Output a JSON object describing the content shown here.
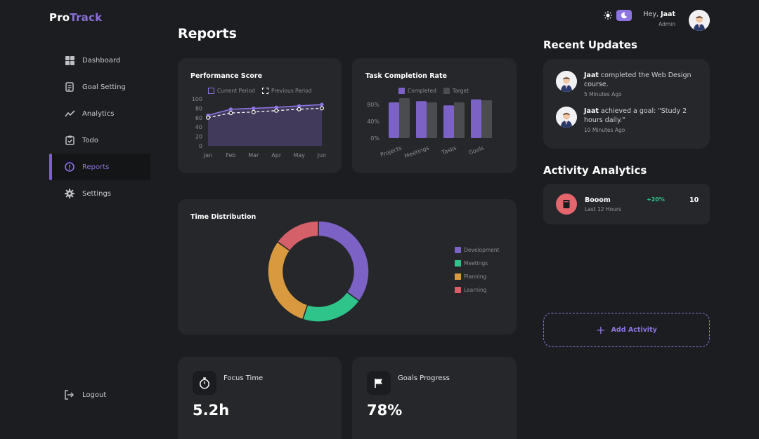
{
  "app": {
    "logo_pro": "Pro",
    "logo_track": "Track"
  },
  "sidebar": {
    "items": [
      {
        "label": "Dashboard",
        "icon": "grid-icon"
      },
      {
        "label": "Goal Setting",
        "icon": "clipboard-icon"
      },
      {
        "label": "Analytics",
        "icon": "trend-line-icon"
      },
      {
        "label": "Todo",
        "icon": "checklist-icon"
      },
      {
        "label": "Reports",
        "icon": "info-circle-icon",
        "active": true
      },
      {
        "label": "Settings",
        "icon": "gear-icon"
      }
    ],
    "logout": "Logout"
  },
  "header": {
    "page_title": "Reports",
    "greeting_prefix": "Hey,",
    "user_name": "Jaat",
    "user_role": "Admin"
  },
  "colors": {
    "accent": "#8d74e0",
    "background": "#1c1d20",
    "card": "#25272a",
    "development": "#7b62c4",
    "meetings": "#2fc48a",
    "planning": "#d99a3f",
    "learning": "#d4606a",
    "positive": "#2fc48a"
  },
  "performance": {
    "title": "Performance Score",
    "legend_current": "Current Period",
    "legend_previous": "Previous Period"
  },
  "completion": {
    "title": "Task Completion Rate",
    "legend_completed": "Completed",
    "legend_target": "Target"
  },
  "distribution": {
    "title": "Time Distribution"
  },
  "chart_data": [
    {
      "type": "line",
      "title": "Performance Score",
      "x": [
        "Jan",
        "Feb",
        "Mar",
        "Apr",
        "May",
        "Jun"
      ],
      "ylim": [
        0,
        100
      ],
      "yticks": [
        0,
        20,
        40,
        60,
        80,
        100
      ],
      "legend": "top",
      "series": [
        {
          "name": "Current Period",
          "values": [
            65,
            78,
            80,
            82,
            85,
            88
          ],
          "color": "#8d74e0",
          "fill": true
        },
        {
          "name": "Previous Period",
          "values": [
            60,
            70,
            72,
            75,
            78,
            80
          ],
          "color": "#ffffff",
          "dashed": true
        }
      ]
    },
    {
      "type": "bar",
      "title": "Task Completion Rate",
      "categories": [
        "Projects",
        "Meetings",
        "Tasks",
        "Goals"
      ],
      "ylim": [
        0,
        100
      ],
      "yticks": [
        "0%",
        "40%",
        "80%"
      ],
      "yticks_values": [
        0,
        40,
        80
      ],
      "legend": "top",
      "series": [
        {
          "name": "Completed",
          "values": [
            85,
            88,
            78,
            92
          ],
          "color": "#7b62c4"
        },
        {
          "name": "Target",
          "values": [
            95,
            85,
            85,
            90
          ],
          "color": "#4a4c50"
        }
      ]
    },
    {
      "type": "pie",
      "title": "Time Distribution",
      "donut": true,
      "labels": [
        "Development",
        "Meetings",
        "Planning",
        "Learning"
      ],
      "values": [
        35,
        20,
        30,
        15
      ],
      "colors": [
        "#7b62c4",
        "#2fc48a",
        "#d99a3f",
        "#d4606a"
      ],
      "legend": "right"
    }
  ],
  "stats": {
    "focus_title": "Focus Time",
    "focus_value": "5.2h",
    "goals_title": "Goals Progress",
    "goals_value": "78%"
  },
  "recent_updates": {
    "title": "Recent Updates",
    "items": [
      {
        "name": "Jaat",
        "action": " completed the Web Design course.",
        "time": "5 Minutes Ago"
      },
      {
        "name": "Jaat",
        "action": " achieved a goal: \"Study 2 hours daily.\"",
        "time": "10 Minutes Ago"
      }
    ]
  },
  "activity": {
    "title": "Activity Analytics",
    "name": "Booom",
    "period": "Last 12 Hours",
    "change": "+20%",
    "count": "10",
    "add_label": "Add Activity"
  }
}
